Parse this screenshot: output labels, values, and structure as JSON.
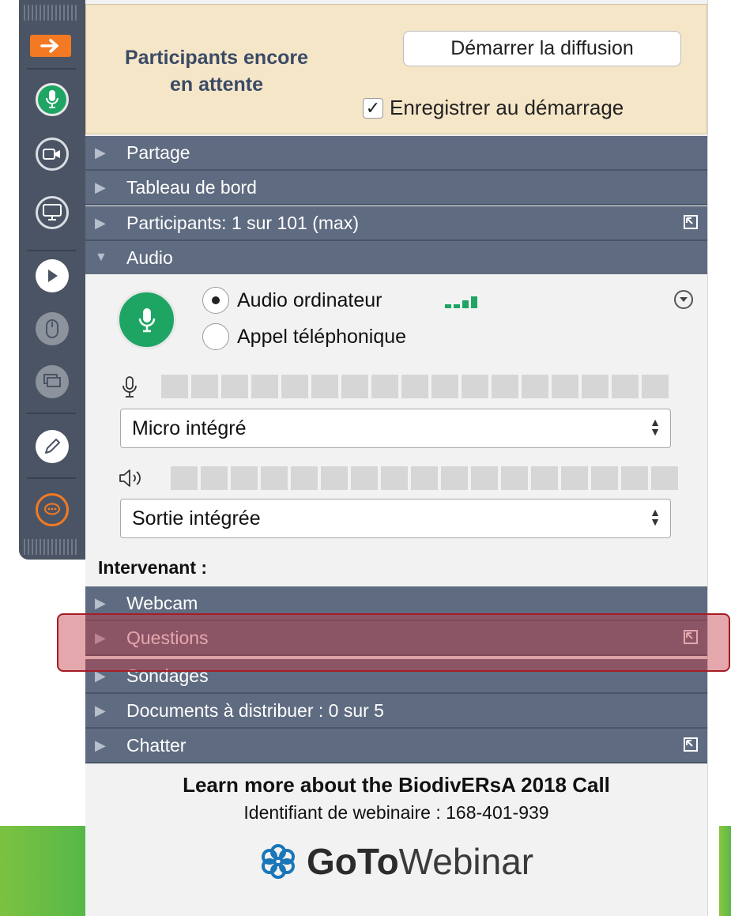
{
  "toolbar": {
    "icons": [
      "arrow-right-icon",
      "microphone-icon",
      "camera-icon",
      "screen-icon",
      "play-icon",
      "mouse-icon",
      "screens-icon",
      "pencil-icon",
      "chat-icon"
    ]
  },
  "banner": {
    "title_line1": "Participants encore",
    "title_line2": "en attente",
    "start_button": "Démarrer la diffusion",
    "record_label": "Enregistrer au démarrage",
    "record_checked": true
  },
  "sections": {
    "sharing": "Partage",
    "dashboard": "Tableau de bord",
    "participants": "Participants: 1 sur 101 (max)",
    "audio": "Audio",
    "webcam": "Webcam",
    "questions": "Questions",
    "polls": "Sondages",
    "handouts": "Documents à distribuer : 0 sur 5",
    "chat": "Chatter"
  },
  "audio": {
    "option_computer": "Audio ordinateur",
    "option_phone": "Appel téléphonique",
    "selected": "computer",
    "microphone_device": "Micro intégré",
    "speaker_device": "Sortie intégrée",
    "mic_level_segments": 17,
    "speaker_level_segments": 17
  },
  "speaker_label": "Intervenant :",
  "footer": {
    "title": "Learn more about the BiodivERsA 2018 Call",
    "webinar_id": "Identifiant de webinaire : 168-401-939",
    "logo_bold": "GoTo",
    "logo_light": "Webinar"
  },
  "colors": {
    "orange": "#f37a22",
    "green": "#1fa563",
    "section_bar": "#5f6b80",
    "banner": "#f5e6c8",
    "highlight": "#c43c46"
  }
}
